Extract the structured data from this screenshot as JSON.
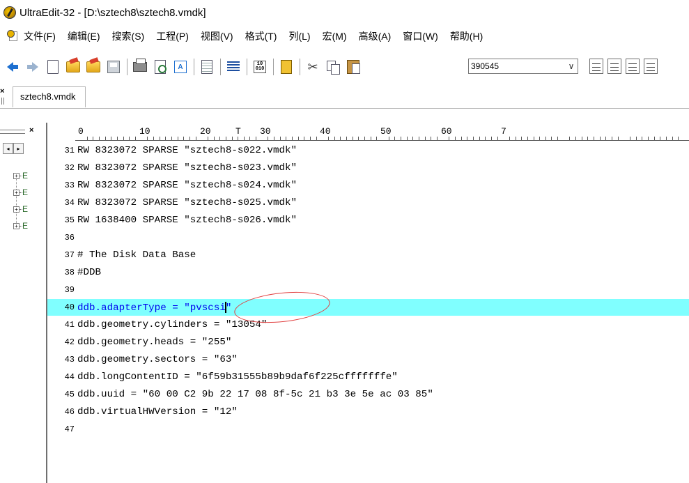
{
  "window": {
    "title": "UltraEdit-32 - [D:\\sztech8\\sztech8.vmdk]"
  },
  "menu": {
    "items": [
      "文件(F)",
      "编辑(E)",
      "搜索(S)",
      "工程(P)",
      "视图(V)",
      "格式(T)",
      "列(L)",
      "宏(M)",
      "高级(A)",
      "窗口(W)",
      "帮助(H)"
    ]
  },
  "toolbar": {
    "combo_value": "390545",
    "combo_arrow": "∨",
    "hex_label": "10\n010",
    "ab_label": "A"
  },
  "tabs": {
    "close_glyph": "×",
    "active_tab": "sztech8.vmdk"
  },
  "left_pane": {
    "close_glyph": "×",
    "nav_prev": "◂",
    "nav_next": "▸",
    "tree_items": [
      "⊞",
      "⊞",
      "⊞",
      "⊞"
    ],
    "tree_node_label": "E"
  },
  "ruler": {
    "labels": [
      "0",
      "10",
      "20",
      "30",
      "40",
      "50",
      "60",
      "7"
    ],
    "cursor_mark": "T"
  },
  "editor": {
    "lines": [
      {
        "n": "31",
        "text": "RW 8323072 SPARSE \"sztech8-s022.vmdk\""
      },
      {
        "n": "32",
        "text": "RW 8323072 SPARSE \"sztech8-s023.vmdk\""
      },
      {
        "n": "33",
        "text": "RW 8323072 SPARSE \"sztech8-s024.vmdk\""
      },
      {
        "n": "34",
        "text": "RW 8323072 SPARSE \"sztech8-s025.vmdk\""
      },
      {
        "n": "35",
        "text": "RW 1638400 SPARSE \"sztech8-s026.vmdk\""
      },
      {
        "n": "36",
        "text": ""
      },
      {
        "n": "37",
        "text": "# The Disk Data Base"
      },
      {
        "n": "38",
        "text": "#DDB"
      },
      {
        "n": "39",
        "text": ""
      },
      {
        "n": "40",
        "text_before_caret": "ddb.adapterType = \"pvscsi",
        "text_after_caret": "\"",
        "highlighted": true
      },
      {
        "n": "41",
        "text": "ddb.geometry.cylinders = \"13054\""
      },
      {
        "n": "42",
        "text": "ddb.geometry.heads = \"255\""
      },
      {
        "n": "43",
        "text": "ddb.geometry.sectors = \"63\""
      },
      {
        "n": "44",
        "text": "ddb.longContentID = \"6f59b31555b89b9daf6f225cfffffffe\""
      },
      {
        "n": "45",
        "text": "ddb.uuid = \"60 00 C2 9b 22 17 08 8f-5c 21 b3 3e 5e ac 03 85\""
      },
      {
        "n": "46",
        "text": "ddb.virtualHWVersion = \"12\""
      },
      {
        "n": "47",
        "text": ""
      }
    ]
  },
  "colors": {
    "highlight_line": "#80ffff",
    "highlight_text": "#0000ee",
    "annotation_circle": "#e04040"
  }
}
